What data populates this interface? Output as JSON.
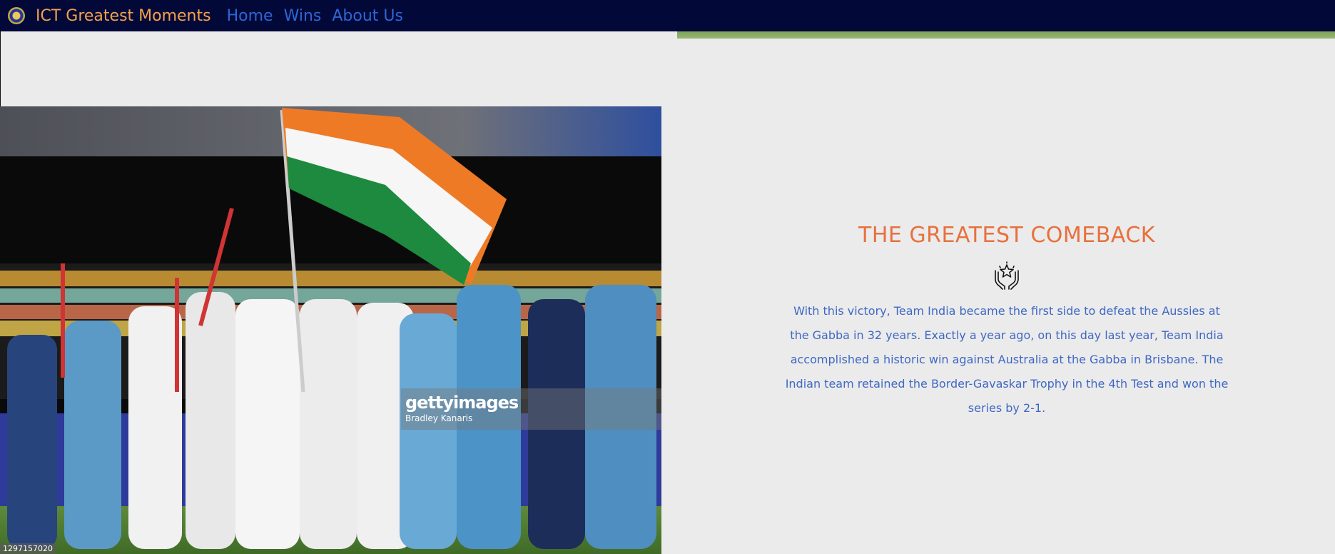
{
  "header": {
    "brand": "ICT Greatest Moments",
    "logo_icon": "bcci-crest-icon",
    "nav": [
      {
        "label": "Home"
      },
      {
        "label": "Wins"
      },
      {
        "label": "About Us"
      }
    ]
  },
  "hero_photo": {
    "watermark_brand": "gettyimages",
    "watermark_credit": "Bradley Kanaris",
    "photo_id": "1297157020"
  },
  "main": {
    "title": "THE GREATEST COMEBACK",
    "icon": "hands-star-trophy-icon",
    "description": "With this victory, Team India became the first side to defeat the Aussies at the Gabba in 32 years. Exactly a year ago, on this day last year, Team India accomplished a historic win against Australia at the Gabba in Brisbane. The Indian team retained the Border-Gavaskar Trophy in the 4th Test and won the series by 2-1."
  },
  "colors": {
    "navbar_bg": "#020939",
    "brand": "#f4a14c",
    "nav_link": "#2d66d6",
    "title": "#e8703e",
    "text": "#3f68c4",
    "page_bg": "#ebebeb"
  }
}
